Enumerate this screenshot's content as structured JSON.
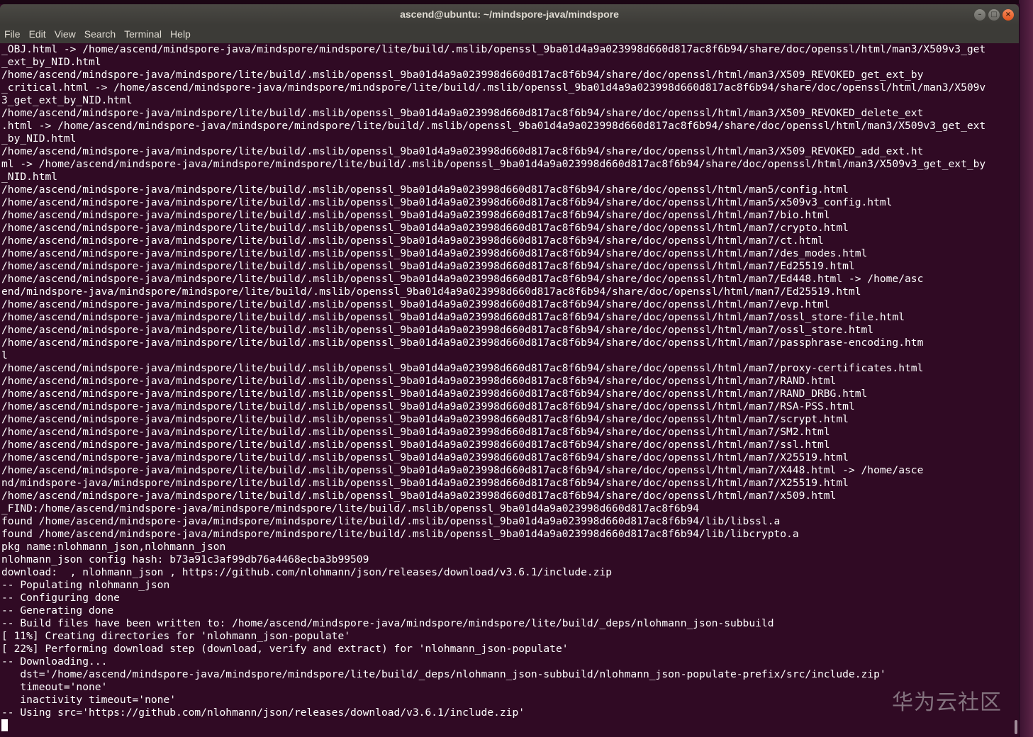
{
  "window": {
    "title": "ascend@ubuntu: ~/mindspore-java/mindspore",
    "controls": {
      "minimize": "–",
      "maximize": "□",
      "close": "×"
    }
  },
  "menu": [
    "File",
    "Edit",
    "View",
    "Search",
    "Terminal",
    "Help"
  ],
  "terminal": {
    "lines": [
      "_OBJ.html -> /home/ascend/mindspore-java/mindspore/mindspore/lite/build/.mslib/openssl_9ba01d4a9a023998d660d817ac8f6b94/share/doc/openssl/html/man3/X509v3_get",
      "_ext_by_NID.html",
      "/home/ascend/mindspore-java/mindspore/lite/build/.mslib/openssl_9ba01d4a9a023998d660d817ac8f6b94/share/doc/openssl/html/man3/X509_REVOKED_get_ext_by",
      "_critical.html -> /home/ascend/mindspore-java/mindspore/mindspore/lite/build/.mslib/openssl_9ba01d4a9a023998d660d817ac8f6b94/share/doc/openssl/html/man3/X509v",
      "3_get_ext_by_NID.html",
      "/home/ascend/mindspore-java/mindspore/lite/build/.mslib/openssl_9ba01d4a9a023998d660d817ac8f6b94/share/doc/openssl/html/man3/X509_REVOKED_delete_ext",
      ".html -> /home/ascend/mindspore-java/mindspore/mindspore/lite/build/.mslib/openssl_9ba01d4a9a023998d660d817ac8f6b94/share/doc/openssl/html/man3/X509v3_get_ext",
      "_by_NID.html",
      "/home/ascend/mindspore-java/mindspore/lite/build/.mslib/openssl_9ba01d4a9a023998d660d817ac8f6b94/share/doc/openssl/html/man3/X509_REVOKED_add_ext.ht",
      "ml -> /home/ascend/mindspore-java/mindspore/mindspore/lite/build/.mslib/openssl_9ba01d4a9a023998d660d817ac8f6b94/share/doc/openssl/html/man3/X509v3_get_ext_by",
      "_NID.html",
      "/home/ascend/mindspore-java/mindspore/lite/build/.mslib/openssl_9ba01d4a9a023998d660d817ac8f6b94/share/doc/openssl/html/man5/config.html",
      "/home/ascend/mindspore-java/mindspore/lite/build/.mslib/openssl_9ba01d4a9a023998d660d817ac8f6b94/share/doc/openssl/html/man5/x509v3_config.html",
      "/home/ascend/mindspore-java/mindspore/lite/build/.mslib/openssl_9ba01d4a9a023998d660d817ac8f6b94/share/doc/openssl/html/man7/bio.html",
      "/home/ascend/mindspore-java/mindspore/lite/build/.mslib/openssl_9ba01d4a9a023998d660d817ac8f6b94/share/doc/openssl/html/man7/crypto.html",
      "/home/ascend/mindspore-java/mindspore/lite/build/.mslib/openssl_9ba01d4a9a023998d660d817ac8f6b94/share/doc/openssl/html/man7/ct.html",
      "/home/ascend/mindspore-java/mindspore/lite/build/.mslib/openssl_9ba01d4a9a023998d660d817ac8f6b94/share/doc/openssl/html/man7/des_modes.html",
      "/home/ascend/mindspore-java/mindspore/lite/build/.mslib/openssl_9ba01d4a9a023998d660d817ac8f6b94/share/doc/openssl/html/man7/Ed25519.html",
      "/home/ascend/mindspore-java/mindspore/lite/build/.mslib/openssl_9ba01d4a9a023998d660d817ac8f6b94/share/doc/openssl/html/man7/Ed448.html -> /home/asc",
      "end/mindspore-java/mindspore/mindspore/lite/build/.mslib/openssl_9ba01d4a9a023998d660d817ac8f6b94/share/doc/openssl/html/man7/Ed25519.html",
      "/home/ascend/mindspore-java/mindspore/lite/build/.mslib/openssl_9ba01d4a9a023998d660d817ac8f6b94/share/doc/openssl/html/man7/evp.html",
      "/home/ascend/mindspore-java/mindspore/lite/build/.mslib/openssl_9ba01d4a9a023998d660d817ac8f6b94/share/doc/openssl/html/man7/ossl_store-file.html",
      "/home/ascend/mindspore-java/mindspore/lite/build/.mslib/openssl_9ba01d4a9a023998d660d817ac8f6b94/share/doc/openssl/html/man7/ossl_store.html",
      "/home/ascend/mindspore-java/mindspore/lite/build/.mslib/openssl_9ba01d4a9a023998d660d817ac8f6b94/share/doc/openssl/html/man7/passphrase-encoding.htm",
      "l",
      "/home/ascend/mindspore-java/mindspore/lite/build/.mslib/openssl_9ba01d4a9a023998d660d817ac8f6b94/share/doc/openssl/html/man7/proxy-certificates.html",
      "/home/ascend/mindspore-java/mindspore/lite/build/.mslib/openssl_9ba01d4a9a023998d660d817ac8f6b94/share/doc/openssl/html/man7/RAND.html",
      "/home/ascend/mindspore-java/mindspore/lite/build/.mslib/openssl_9ba01d4a9a023998d660d817ac8f6b94/share/doc/openssl/html/man7/RAND_DRBG.html",
      "/home/ascend/mindspore-java/mindspore/lite/build/.mslib/openssl_9ba01d4a9a023998d660d817ac8f6b94/share/doc/openssl/html/man7/RSA-PSS.html",
      "/home/ascend/mindspore-java/mindspore/lite/build/.mslib/openssl_9ba01d4a9a023998d660d817ac8f6b94/share/doc/openssl/html/man7/scrypt.html",
      "/home/ascend/mindspore-java/mindspore/lite/build/.mslib/openssl_9ba01d4a9a023998d660d817ac8f6b94/share/doc/openssl/html/man7/SM2.html",
      "/home/ascend/mindspore-java/mindspore/lite/build/.mslib/openssl_9ba01d4a9a023998d660d817ac8f6b94/share/doc/openssl/html/man7/ssl.html",
      "/home/ascend/mindspore-java/mindspore/lite/build/.mslib/openssl_9ba01d4a9a023998d660d817ac8f6b94/share/doc/openssl/html/man7/X25519.html",
      "/home/ascend/mindspore-java/mindspore/lite/build/.mslib/openssl_9ba01d4a9a023998d660d817ac8f6b94/share/doc/openssl/html/man7/X448.html -> /home/asce",
      "nd/mindspore-java/mindspore/mindspore/lite/build/.mslib/openssl_9ba01d4a9a023998d660d817ac8f6b94/share/doc/openssl/html/man7/X25519.html",
      "/home/ascend/mindspore-java/mindspore/lite/build/.mslib/openssl_9ba01d4a9a023998d660d817ac8f6b94/share/doc/openssl/html/man7/x509.html",
      "_FIND:/home/ascend/mindspore-java/mindspore/mindspore/lite/build/.mslib/openssl_9ba01d4a9a023998d660d817ac8f6b94",
      "found /home/ascend/mindspore-java/mindspore/mindspore/lite/build/.mslib/openssl_9ba01d4a9a023998d660d817ac8f6b94/lib/libssl.a",
      "found /home/ascend/mindspore-java/mindspore/mindspore/lite/build/.mslib/openssl_9ba01d4a9a023998d660d817ac8f6b94/lib/libcrypto.a",
      "pkg name:nlohmann_json,nlohmann_json",
      "nlohmann_json config hash: b73a91c3af99db76a4468ecba3b99509",
      "download:  , nlohmann_json , https://github.com/nlohmann/json/releases/download/v3.6.1/include.zip",
      "-- Populating nlohmann_json",
      "-- Configuring done",
      "-- Generating done",
      "-- Build files have been written to: /home/ascend/mindspore-java/mindspore/mindspore/lite/build/_deps/nlohmann_json-subbuild",
      "[ 11%] Creating directories for 'nlohmann_json-populate'",
      "[ 22%] Performing download step (download, verify and extract) for 'nlohmann_json-populate'",
      "-- Downloading...",
      "   dst='/home/ascend/mindspore-java/mindspore/mindspore/lite/build/_deps/nlohmann_json-subbuild/nlohmann_json-populate-prefix/src/include.zip'",
      "   timeout='none'",
      "   inactivity timeout='none'",
      "-- Using src='https://github.com/nlohmann/json/releases/download/v3.6.1/include.zip'"
    ]
  },
  "watermark": "华为云社区",
  "colors": {
    "terminal_bg": "#300a24",
    "terminal_fg": "#ffffff",
    "titlebar_bg": "#3c3b37",
    "close_button": "#e3541d"
  }
}
